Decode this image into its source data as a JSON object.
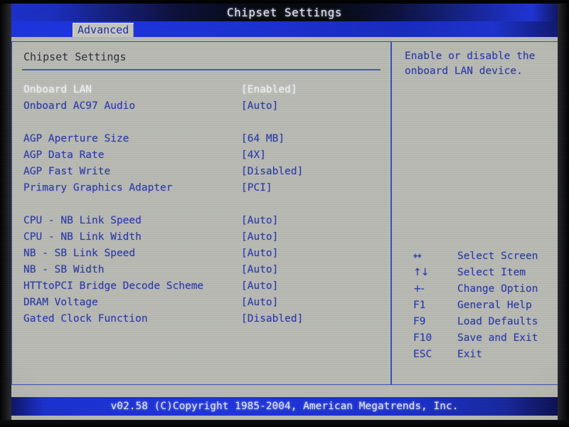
{
  "window": {
    "title": "Chipset Settings"
  },
  "menu": {
    "tabs": [
      {
        "label": "Advanced",
        "active": true
      }
    ]
  },
  "main": {
    "section_title": "Chipset Settings",
    "settings": [
      {
        "label": "Onboard LAN",
        "value": "[Enabled]",
        "selected": true
      },
      {
        "label": "Onboard AC97 Audio",
        "value": "[Auto]",
        "selected": false
      },
      {
        "spacer": true
      },
      {
        "label": "AGP Aperture Size",
        "value": "[64 MB]",
        "selected": false
      },
      {
        "label": "AGP Data Rate",
        "value": "[4X]",
        "selected": false
      },
      {
        "label": "AGP Fast Write",
        "value": "[Disabled]",
        "selected": false
      },
      {
        "label": "Primary Graphics Adapter",
        "value": "[PCI]",
        "selected": false
      },
      {
        "spacer": true
      },
      {
        "label": "CPU - NB Link Speed",
        "value": "[Auto]",
        "selected": false
      },
      {
        "label": "CPU - NB Link Width",
        "value": "[Auto]",
        "selected": false
      },
      {
        "label": "NB - SB Link Speed",
        "value": "[Auto]",
        "selected": false
      },
      {
        "label": "NB - SB Width",
        "value": "[Auto]",
        "selected": false
      },
      {
        "label": "HTTtoPCI Bridge Decode Scheme",
        "value": "[Auto]",
        "selected": false
      },
      {
        "label": "DRAM Voltage",
        "value": "[Auto]",
        "selected": false
      },
      {
        "label": "Gated Clock Function",
        "value": "[Disabled]",
        "selected": false
      }
    ]
  },
  "help": {
    "text": "Enable or disable the onboard LAN device.",
    "keys": [
      {
        "key": "↔",
        "desc": "Select Screen",
        "symbol": true
      },
      {
        "key": "↑↓",
        "desc": "Select Item",
        "symbol": true
      },
      {
        "key": "+-",
        "desc": "Change Option",
        "symbol": true
      },
      {
        "key": "F1",
        "desc": "General Help",
        "symbol": false
      },
      {
        "key": "F9",
        "desc": "Load Defaults",
        "symbol": false
      },
      {
        "key": "F10",
        "desc": "Save and Exit",
        "symbol": false
      },
      {
        "key": "ESC",
        "desc": "Exit",
        "symbol": false
      }
    ]
  },
  "footer": {
    "text": "v02.58 (C)Copyright 1985-2004, American Megatrends, Inc."
  },
  "colors": {
    "screen_background": "#b9bab4",
    "text_blue": "#2b3ba8",
    "text_selected": "#f2f3f0",
    "panel_border": "#3a4fb5",
    "title_bar_blue": "#1b2fd0",
    "menu_bar_blue": "#1a30d6",
    "section_title": "#2d2f36"
  }
}
